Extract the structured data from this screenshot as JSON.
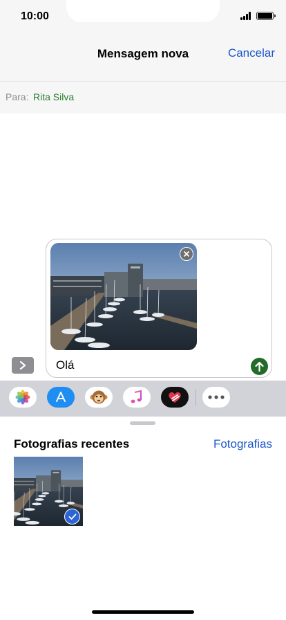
{
  "status": {
    "time": "10:00"
  },
  "nav": {
    "title": "Mensagem nova",
    "cancel_label": "Cancelar"
  },
  "recipient": {
    "label": "Para:",
    "name": "Rita Silva"
  },
  "composer": {
    "message_text": "Olá"
  },
  "app_strip": {
    "apps": [
      "photos-icon",
      "app-store-icon",
      "animoji-icon",
      "music-icon",
      "digital-touch-icon",
      "more-icon"
    ]
  },
  "photos": {
    "title": "Fotografias recentes",
    "link_label": "Fotografias",
    "selected_count": 1
  },
  "colors": {
    "accent": "#1b56c9",
    "contact_green": "#2a7d2e",
    "send_green": "#246b2a"
  }
}
